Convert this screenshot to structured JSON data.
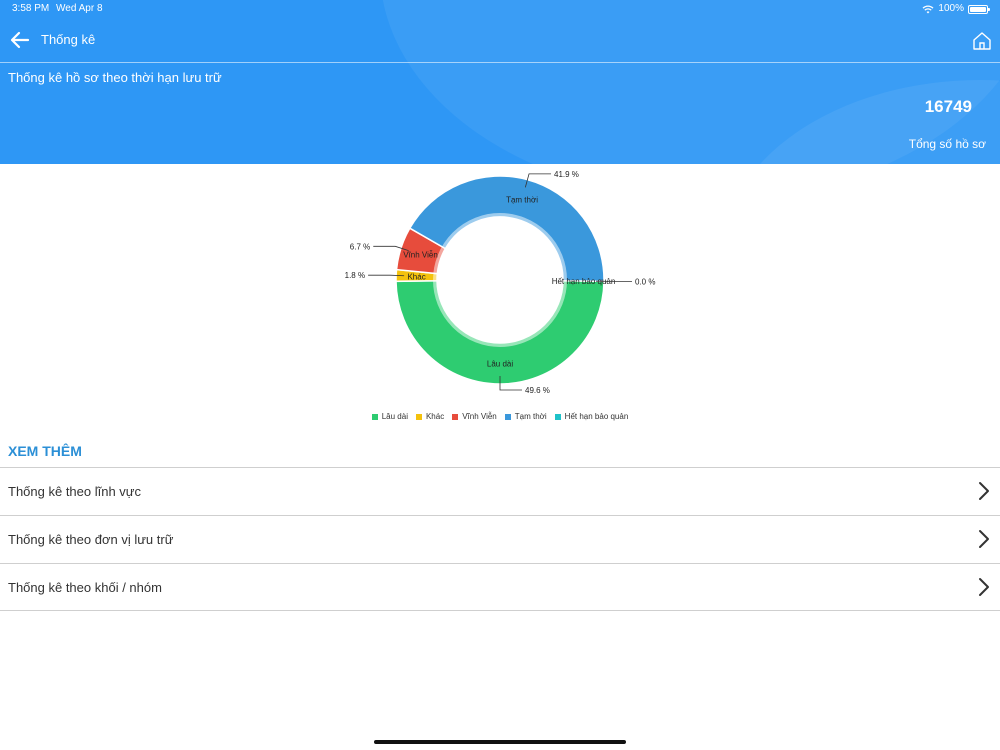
{
  "status_bar": {
    "time": "3:58 PM",
    "date": "Wed Apr 8",
    "battery": "100%",
    "icons": [
      "wifi-icon",
      "battery-icon"
    ]
  },
  "nav": {
    "title": "Thống kê",
    "back_icon": "arrow-left-icon",
    "home_icon": "home-icon"
  },
  "banner": {
    "title": "Thống kê hồ sơ theo thời hạn lưu trữ",
    "total_value": "16749",
    "total_label": "Tổng số hồ sơ"
  },
  "colors": {
    "header_bg": "#2e97f5",
    "section_title": "#2b8fd6"
  },
  "chart_data": {
    "type": "pie",
    "donut": true,
    "legend_position": "bottom",
    "categories": [
      "Lâu dài",
      "Khác",
      "Vĩnh Viễn",
      "Tạm thời",
      "Hết hạn bảo quản"
    ],
    "values": [
      49.6,
      1.8,
      6.7,
      41.9,
      0.0
    ],
    "value_labels": [
      "49.6 %",
      "1.8 %",
      "6.7 %",
      "41.9 %",
      "0.0 %"
    ],
    "colors": [
      "#2ecc71",
      "#f4c20d",
      "#e74c3c",
      "#3a98dc",
      "#1fc2c9"
    ]
  },
  "more": {
    "title": "XEM THÊM",
    "items": [
      {
        "label": "Thống kê theo lĩnh vực"
      },
      {
        "label": "Thống kê theo đơn vị lưu trữ"
      },
      {
        "label": "Thống kê theo khối / nhóm"
      }
    ],
    "chevron_icon": "chevron-right-icon"
  }
}
